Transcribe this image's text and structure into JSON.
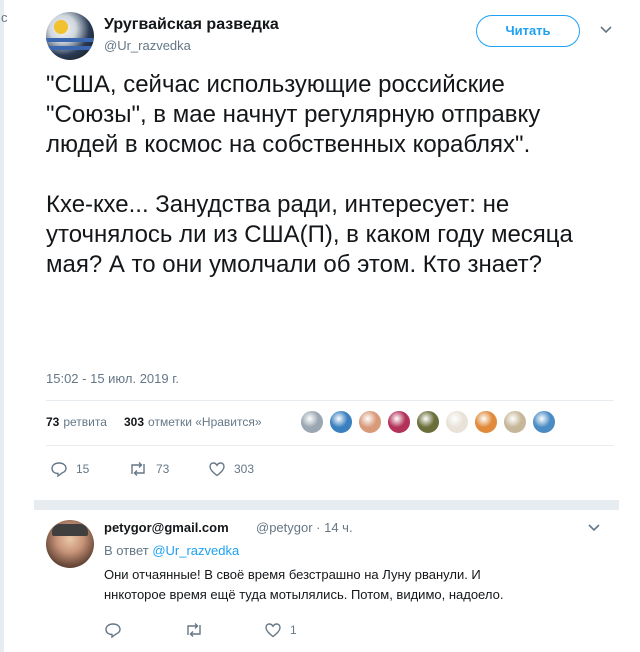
{
  "tweet": {
    "name": "Уругвайская разведка",
    "handle": "@Ur_razvedka",
    "follow_label": "Читать",
    "text": "\"США, сейчас использующие российские \"Союзы\", в мае начнут регулярную отправку людей в космос на собственных кораблях\".\n\nКхе-кхе... Занудства ради, интересует: не уточнялось ли из США(П), в каком году месяца мая? А то они умолчали об этом. Кто знает?",
    "timestamp": "15:02 - 15 июл. 2019 г.",
    "retweets_count": "73",
    "retweets_label": "ретвита",
    "likes_count": "303",
    "likes_label": "отметки «Нравится»",
    "actions": {
      "replies": "15",
      "retweets": "73",
      "likes": "303"
    },
    "liker_colors": [
      "#9aa6b2",
      "#3a7fc0",
      "#d99a7a",
      "#b3325a",
      "#6a6f3a",
      "#e8e2d8",
      "#e08a3a",
      "#c7b79a",
      "#4a8bc4"
    ]
  },
  "reply": {
    "name": "petygor@gmail.com",
    "handle_meta": "@petygor · 14 ч.",
    "in_reply_prefix": "В ответ",
    "in_reply_handle": "@Ur_razvedka",
    "text": "Они отчаянные! В своё время безстрашно на Луну рванули. И ннкоторое время ещё туда мотылялись. Потом, видимо, надоело.",
    "like_count": "1"
  },
  "icons": {
    "reply": "reply-icon",
    "retweet": "retweet-icon",
    "like": "heart-icon",
    "more": "chevron-down-icon"
  },
  "colors": {
    "accent": "#1da1f2",
    "muted": "#657786",
    "divider": "#e6ecf0"
  },
  "corner_glyph": "c"
}
